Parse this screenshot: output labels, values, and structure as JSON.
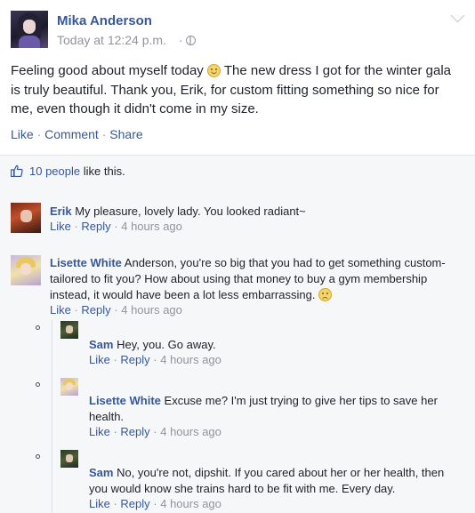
{
  "post": {
    "author": "Mika Anderson",
    "time": "Today at 12:24 p.m.",
    "time_separator": "·",
    "text_before_emoji": "Feeling good about myself today ",
    "text_after_emoji": " The new dress I got for the winter gala is truly beautiful. Thank you, Erik, for custom fitting something so nice for me, even though it didn't come in my size.",
    "actions": {
      "like": "Like",
      "comment": "Comment",
      "share": "Share",
      "separator": " · "
    }
  },
  "likes": {
    "count_text": "10 people",
    "suffix": " like this."
  },
  "icons": {
    "privacy": "globe-icon",
    "options": "chevron-down-icon",
    "like": "thumbs-up-icon",
    "emoji_smile": "smile-emoji-icon",
    "emoji_frown": "frown-emoji-icon"
  },
  "comments": [
    {
      "name": "Erik",
      "text": " My pleasure, lovely lady. You looked radiant~",
      "like": "Like",
      "reply": "Reply",
      "time": "4 hours ago"
    },
    {
      "name": "Lisette White",
      "text": " Anderson, you're so big that you had to get something custom-tailored to fit you? How about using that money to buy a gym membership instead, it would have been a lot less embarrassing. ",
      "like": "Like",
      "reply": "Reply",
      "time": "4 hours ago"
    }
  ],
  "replies": [
    {
      "name": "Sam",
      "text": " Hey, you. Go away.",
      "like": "Like",
      "reply": "Reply",
      "time": "4 hours ago"
    },
    {
      "name": "Lisette White",
      "text": " Excuse me? I'm just trying to give her tips to save her health.",
      "like": "Like",
      "reply": "Reply",
      "time": "4 hours ago"
    },
    {
      "name": "Sam",
      "text": " No, you're not, dipshit. If you cared about her or her health, then you would know she trains hard to be fit with me. Every day.",
      "like": "Like",
      "reply": "Reply",
      "time": "4 hours ago"
    }
  ],
  "colors": {
    "link": "#365899",
    "muted": "#90949c",
    "text": "#1d2129",
    "panel_bg": "#f6f7f9"
  }
}
